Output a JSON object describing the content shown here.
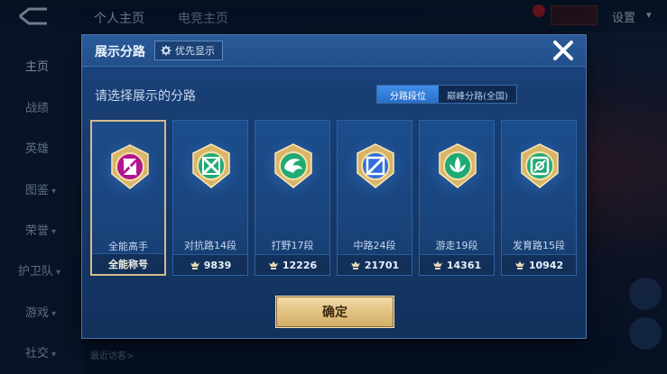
{
  "app": {
    "top_tabs": [
      "个人主页",
      "电竞主页"
    ],
    "settings_label": "设置"
  },
  "sidenav": {
    "items": [
      {
        "label": "主页",
        "active": true
      },
      {
        "label": "战绩"
      },
      {
        "label": "英雄"
      },
      {
        "label": "图鉴",
        "caret": "▾"
      },
      {
        "label": "荣誉",
        "caret": "▾"
      },
      {
        "label": "护卫队",
        "caret": "▾"
      },
      {
        "label": "游戏",
        "caret": "▾"
      },
      {
        "label": "社交",
        "caret": "▾"
      }
    ]
  },
  "background": {
    "recent_visitors": "最近访客>"
  },
  "modal": {
    "title": "展示分路",
    "priority_label": "优先显示",
    "prompt": "请选择展示的分路",
    "tabs": [
      {
        "label": "分路段位",
        "active": true
      },
      {
        "label": "巅峰分路(全国)",
        "active": false
      }
    ],
    "cards": [
      {
        "name": "全能高手",
        "score": "全能称号",
        "selected": true,
        "icon": "all-round-emblem-icon",
        "color": "#b3148f",
        "show_score_icon": false
      },
      {
        "name": "对抗路14段",
        "score": "9839",
        "selected": false,
        "icon": "clash-lane-emblem-icon",
        "color": "#1faa74",
        "show_score_icon": true
      },
      {
        "name": "打野17段",
        "score": "12226",
        "selected": false,
        "icon": "jungle-emblem-icon",
        "color": "#1faa74",
        "show_score_icon": true
      },
      {
        "name": "中路24段",
        "score": "21701",
        "selected": false,
        "icon": "mid-lane-emblem-icon",
        "color": "#2f6fd8",
        "show_score_icon": true
      },
      {
        "name": "游走19段",
        "score": "14361",
        "selected": false,
        "icon": "roam-emblem-icon",
        "color": "#1faa74",
        "show_score_icon": true
      },
      {
        "name": "发育路15段",
        "score": "10942",
        "selected": false,
        "icon": "farm-lane-emblem-icon",
        "color": "#1faa74",
        "show_score_icon": true
      }
    ],
    "confirm_label": "确定",
    "accent_gold": "#e3c283",
    "accent_blue": "#2b6fc9"
  }
}
